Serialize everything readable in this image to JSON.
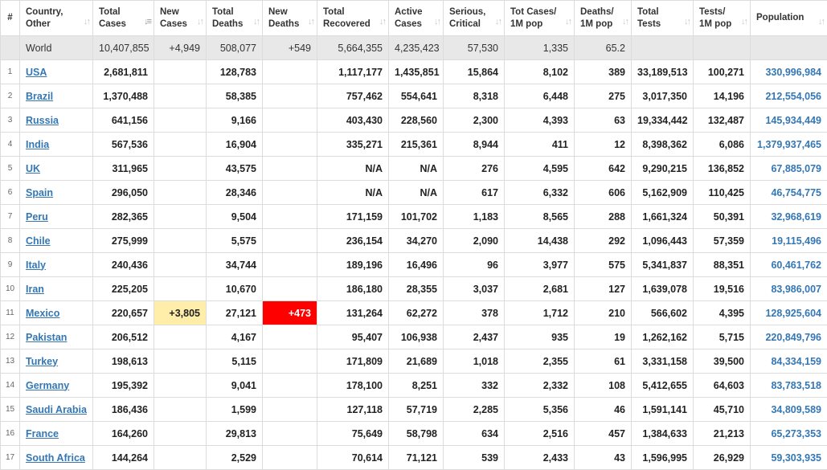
{
  "headers": [
    {
      "key": "idx",
      "label": "#"
    },
    {
      "key": "country",
      "label": "Country, Other"
    },
    {
      "key": "total_cases",
      "label": "Total Cases"
    },
    {
      "key": "new_cases",
      "label": "New Cases"
    },
    {
      "key": "total_deaths",
      "label": "Total Deaths"
    },
    {
      "key": "new_deaths",
      "label": "New Deaths"
    },
    {
      "key": "total_recovered",
      "label": "Total Recovered"
    },
    {
      "key": "active_cases",
      "label": "Active Cases"
    },
    {
      "key": "serious_critical",
      "label": "Serious, Critical"
    },
    {
      "key": "cases_per_1m",
      "label": "Tot Cases/ 1M pop"
    },
    {
      "key": "deaths_per_1m",
      "label": "Deaths/ 1M pop"
    },
    {
      "key": "total_tests",
      "label": "Total Tests"
    },
    {
      "key": "tests_per_1m",
      "label": "Tests/ 1M pop"
    },
    {
      "key": "population",
      "label": "Population"
    }
  ],
  "sort_icon": "sort-arrows-icon",
  "sort_icon_glyph": "↓↑",
  "sorted_icon_glyph": "↓≡",
  "sorted_column": "total_cases",
  "world": {
    "idx": "",
    "country": "World",
    "total_cases": "10,407,855",
    "new_cases": "+4,949",
    "total_deaths": "508,077",
    "new_deaths": "+549",
    "total_recovered": "5,664,355",
    "active_cases": "4,235,423",
    "serious_critical": "57,530",
    "cases_per_1m": "1,335",
    "deaths_per_1m": "65.2",
    "total_tests": "",
    "tests_per_1m": "",
    "population": ""
  },
  "highlight_colors": {
    "new_cases": "#ffeeaa",
    "new_deaths": "#ff0000",
    "link": "#3477b4"
  },
  "rows": [
    {
      "idx": "1",
      "country": "USA",
      "total_cases": "2,681,811",
      "new_cases": "",
      "total_deaths": "128,783",
      "new_deaths": "",
      "total_recovered": "1,117,177",
      "active_cases": "1,435,851",
      "serious_critical": "15,864",
      "cases_per_1m": "8,102",
      "deaths_per_1m": "389",
      "total_tests": "33,189,513",
      "tests_per_1m": "100,271",
      "population": "330,996,984"
    },
    {
      "idx": "2",
      "country": "Brazil",
      "total_cases": "1,370,488",
      "new_cases": "",
      "total_deaths": "58,385",
      "new_deaths": "",
      "total_recovered": "757,462",
      "active_cases": "554,641",
      "serious_critical": "8,318",
      "cases_per_1m": "6,448",
      "deaths_per_1m": "275",
      "total_tests": "3,017,350",
      "tests_per_1m": "14,196",
      "population": "212,554,056"
    },
    {
      "idx": "3",
      "country": "Russia",
      "total_cases": "641,156",
      "new_cases": "",
      "total_deaths": "9,166",
      "new_deaths": "",
      "total_recovered": "403,430",
      "active_cases": "228,560",
      "serious_critical": "2,300",
      "cases_per_1m": "4,393",
      "deaths_per_1m": "63",
      "total_tests": "19,334,442",
      "tests_per_1m": "132,487",
      "population": "145,934,449"
    },
    {
      "idx": "4",
      "country": "India",
      "total_cases": "567,536",
      "new_cases": "",
      "total_deaths": "16,904",
      "new_deaths": "",
      "total_recovered": "335,271",
      "active_cases": "215,361",
      "serious_critical": "8,944",
      "cases_per_1m": "411",
      "deaths_per_1m": "12",
      "total_tests": "8,398,362",
      "tests_per_1m": "6,086",
      "population": "1,379,937,465"
    },
    {
      "idx": "5",
      "country": "UK",
      "total_cases": "311,965",
      "new_cases": "",
      "total_deaths": "43,575",
      "new_deaths": "",
      "total_recovered": "N/A",
      "active_cases": "N/A",
      "serious_critical": "276",
      "cases_per_1m": "4,595",
      "deaths_per_1m": "642",
      "total_tests": "9,290,215",
      "tests_per_1m": "136,852",
      "population": "67,885,079"
    },
    {
      "idx": "6",
      "country": "Spain",
      "total_cases": "296,050",
      "new_cases": "",
      "total_deaths": "28,346",
      "new_deaths": "",
      "total_recovered": "N/A",
      "active_cases": "N/A",
      "serious_critical": "617",
      "cases_per_1m": "6,332",
      "deaths_per_1m": "606",
      "total_tests": "5,162,909",
      "tests_per_1m": "110,425",
      "population": "46,754,775"
    },
    {
      "idx": "7",
      "country": "Peru",
      "total_cases": "282,365",
      "new_cases": "",
      "total_deaths": "9,504",
      "new_deaths": "",
      "total_recovered": "171,159",
      "active_cases": "101,702",
      "serious_critical": "1,183",
      "cases_per_1m": "8,565",
      "deaths_per_1m": "288",
      "total_tests": "1,661,324",
      "tests_per_1m": "50,391",
      "population": "32,968,619"
    },
    {
      "idx": "8",
      "country": "Chile",
      "total_cases": "275,999",
      "new_cases": "",
      "total_deaths": "5,575",
      "new_deaths": "",
      "total_recovered": "236,154",
      "active_cases": "34,270",
      "serious_critical": "2,090",
      "cases_per_1m": "14,438",
      "deaths_per_1m": "292",
      "total_tests": "1,096,443",
      "tests_per_1m": "57,359",
      "population": "19,115,496"
    },
    {
      "idx": "9",
      "country": "Italy",
      "total_cases": "240,436",
      "new_cases": "",
      "total_deaths": "34,744",
      "new_deaths": "",
      "total_recovered": "189,196",
      "active_cases": "16,496",
      "serious_critical": "96",
      "cases_per_1m": "3,977",
      "deaths_per_1m": "575",
      "total_tests": "5,341,837",
      "tests_per_1m": "88,351",
      "population": "60,461,762"
    },
    {
      "idx": "10",
      "country": "Iran",
      "total_cases": "225,205",
      "new_cases": "",
      "total_deaths": "10,670",
      "new_deaths": "",
      "total_recovered": "186,180",
      "active_cases": "28,355",
      "serious_critical": "3,037",
      "cases_per_1m": "2,681",
      "deaths_per_1m": "127",
      "total_tests": "1,639,078",
      "tests_per_1m": "19,516",
      "population": "83,986,007"
    },
    {
      "idx": "11",
      "country": "Mexico",
      "total_cases": "220,657",
      "new_cases": "+3,805",
      "total_deaths": "27,121",
      "new_deaths": "+473",
      "total_recovered": "131,264",
      "active_cases": "62,272",
      "serious_critical": "378",
      "cases_per_1m": "1,712",
      "deaths_per_1m": "210",
      "total_tests": "566,602",
      "tests_per_1m": "4,395",
      "population": "128,925,604"
    },
    {
      "idx": "12",
      "country": "Pakistan",
      "total_cases": "206,512",
      "new_cases": "",
      "total_deaths": "4,167",
      "new_deaths": "",
      "total_recovered": "95,407",
      "active_cases": "106,938",
      "serious_critical": "2,437",
      "cases_per_1m": "935",
      "deaths_per_1m": "19",
      "total_tests": "1,262,162",
      "tests_per_1m": "5,715",
      "population": "220,849,796"
    },
    {
      "idx": "13",
      "country": "Turkey",
      "total_cases": "198,613",
      "new_cases": "",
      "total_deaths": "5,115",
      "new_deaths": "",
      "total_recovered": "171,809",
      "active_cases": "21,689",
      "serious_critical": "1,018",
      "cases_per_1m": "2,355",
      "deaths_per_1m": "61",
      "total_tests": "3,331,158",
      "tests_per_1m": "39,500",
      "population": "84,334,159"
    },
    {
      "idx": "14",
      "country": "Germany",
      "total_cases": "195,392",
      "new_cases": "",
      "total_deaths": "9,041",
      "new_deaths": "",
      "total_recovered": "178,100",
      "active_cases": "8,251",
      "serious_critical": "332",
      "cases_per_1m": "2,332",
      "deaths_per_1m": "108",
      "total_tests": "5,412,655",
      "tests_per_1m": "64,603",
      "population": "83,783,518"
    },
    {
      "idx": "15",
      "country": "Saudi Arabia",
      "total_cases": "186,436",
      "new_cases": "",
      "total_deaths": "1,599",
      "new_deaths": "",
      "total_recovered": "127,118",
      "active_cases": "57,719",
      "serious_critical": "2,285",
      "cases_per_1m": "5,356",
      "deaths_per_1m": "46",
      "total_tests": "1,591,141",
      "tests_per_1m": "45,710",
      "population": "34,809,589"
    },
    {
      "idx": "16",
      "country": "France",
      "total_cases": "164,260",
      "new_cases": "",
      "total_deaths": "29,813",
      "new_deaths": "",
      "total_recovered": "75,649",
      "active_cases": "58,798",
      "serious_critical": "634",
      "cases_per_1m": "2,516",
      "deaths_per_1m": "457",
      "total_tests": "1,384,633",
      "tests_per_1m": "21,213",
      "population": "65,273,353"
    },
    {
      "idx": "17",
      "country": "South Africa",
      "total_cases": "144,264",
      "new_cases": "",
      "total_deaths": "2,529",
      "new_deaths": "",
      "total_recovered": "70,614",
      "active_cases": "71,121",
      "serious_critical": "539",
      "cases_per_1m": "2,433",
      "deaths_per_1m": "43",
      "total_tests": "1,596,995",
      "tests_per_1m": "26,929",
      "population": "59,303,935"
    }
  ]
}
